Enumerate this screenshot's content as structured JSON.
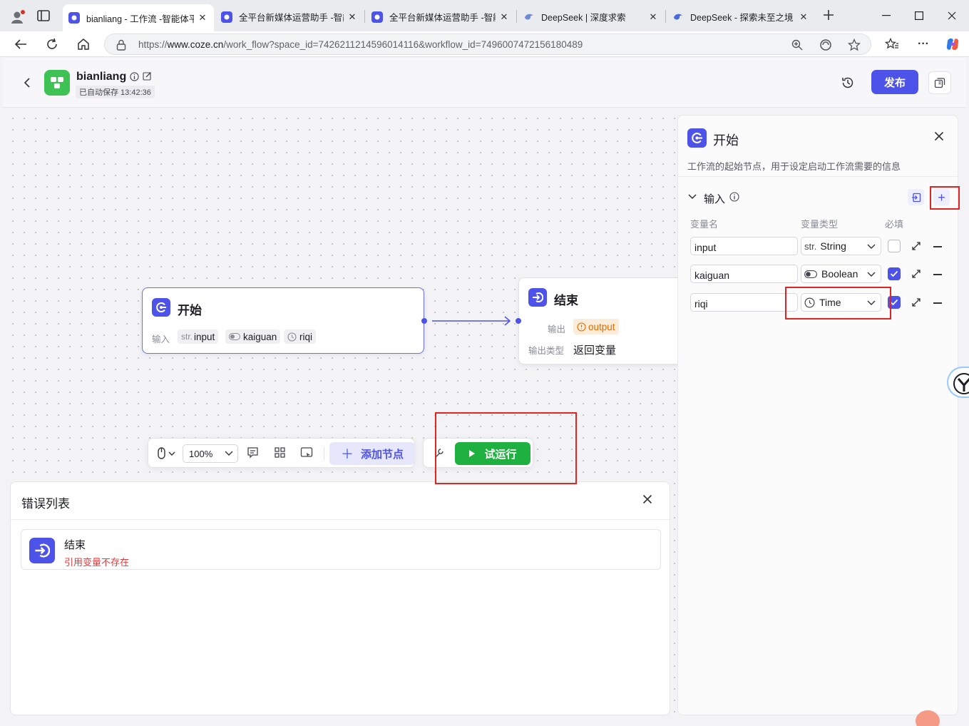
{
  "browser": {
    "tabs": [
      {
        "title": "bianliang - 工作流 -智能体平台",
        "active": true
      },
      {
        "title": "全平台新媒体运营助手 -智能体",
        "active": false
      },
      {
        "title": "全平台新媒体运营助手 -智能体",
        "active": false
      },
      {
        "title": "DeepSeek | 深度求索",
        "active": false
      },
      {
        "title": "DeepSeek - 探索未至之境",
        "active": false
      }
    ],
    "url_prefix": "https://",
    "url_domain": "www.coze.cn",
    "url_path": "/work_flow?space_id=7426211214596014116&workflow_id=7496007472156180489"
  },
  "header": {
    "app_name": "bianliang",
    "autosave": "已自动保存 13:42:36",
    "publish_label": "发布"
  },
  "start_node": {
    "title": "开始",
    "input_label": "输入",
    "vars": [
      {
        "prefix": "str.",
        "name": "input"
      },
      {
        "icon": "toggle-icon",
        "name": "kaiguan"
      },
      {
        "icon": "clock-icon",
        "name": "riqi"
      }
    ]
  },
  "end_node": {
    "title": "结束",
    "output_label": "输出",
    "output_chip": "output",
    "output_type_label": "输出类型",
    "output_type_value": "返回变量"
  },
  "toolbar": {
    "zoom": "100%",
    "add_node_label": "添加节点",
    "trial_run_label": "试运行"
  },
  "error_panel": {
    "title": "错误列表",
    "items": [
      {
        "node": "结束",
        "message": "引用变量不存在"
      }
    ]
  },
  "right_panel": {
    "title": "开始",
    "description": "工作流的起始节点，用于设定启动工作流需要的信息",
    "section_title": "输入",
    "col_name": "变量名",
    "col_type": "变量类型",
    "col_required": "必填",
    "rows": [
      {
        "name": "input",
        "type_prefix": "str.",
        "type": "String",
        "required": false
      },
      {
        "name": "kaiguan",
        "type_icon": "toggle-icon",
        "type": "Boolean",
        "required": true
      },
      {
        "name": "riqi",
        "type_icon": "clock-icon",
        "type": "Time",
        "required": true
      }
    ]
  },
  "colors": {
    "brand": "#4d53e8",
    "run_green": "#1fb13f",
    "highlight_red": "#e12424",
    "error_text": "#e23a3a"
  }
}
